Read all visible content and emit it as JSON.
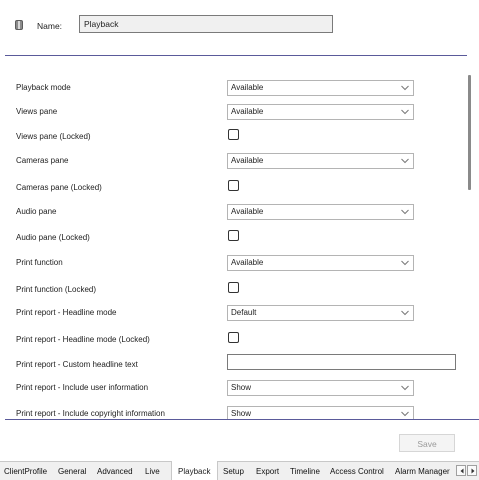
{
  "header": {
    "name_label": "Name:",
    "name_value": "Playback"
  },
  "rows": [
    {
      "label": "Playback mode",
      "type": "select",
      "value": "Available"
    },
    {
      "label": "Views pane",
      "type": "select",
      "value": "Available"
    },
    {
      "label": "Views pane (Locked)",
      "type": "checkbox",
      "checked": false
    },
    {
      "label": "Cameras pane",
      "type": "select",
      "value": "Available"
    },
    {
      "label": "Cameras pane (Locked)",
      "type": "checkbox",
      "checked": false
    },
    {
      "label": "Audio pane",
      "type": "select",
      "value": "Available"
    },
    {
      "label": "Audio pane (Locked)",
      "type": "checkbox",
      "checked": false
    },
    {
      "label": "Print function",
      "type": "select",
      "value": "Available"
    },
    {
      "label": "Print function (Locked)",
      "type": "checkbox",
      "checked": false
    },
    {
      "label": "Print report - Headline mode",
      "type": "select",
      "value": "Default"
    },
    {
      "label": "Print report - Headline mode (Locked)",
      "type": "checkbox",
      "checked": false
    },
    {
      "label": "Print report - Custom headline text",
      "type": "text",
      "value": ""
    },
    {
      "label": "Print report - Include user information",
      "type": "select",
      "value": "Show"
    },
    {
      "label": "Print report - Include copyright information",
      "type": "select",
      "value": "Show"
    }
  ],
  "footer": {
    "save_label": "Save"
  },
  "tabs": {
    "clientprofile": "ClientProfile",
    "general": "General",
    "advanced": "Advanced",
    "live": "Live",
    "playback": "Playback",
    "setup": "Setup",
    "export": "Export",
    "timeline": "Timeline",
    "access_control": "Access Control",
    "alarm_manager": "Alarm Manager",
    "active_tab": "Playback"
  },
  "colors": {
    "separator": "#5a5a9a",
    "select_border": "#b4b4b4",
    "tab_bar_bg": "#f0f0f0"
  }
}
